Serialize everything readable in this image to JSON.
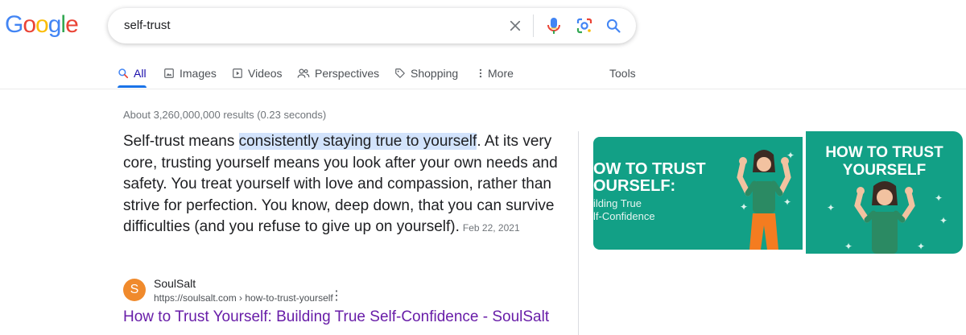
{
  "logo": {
    "text": [
      "G",
      "o",
      "o",
      "g",
      "l",
      "e"
    ],
    "colors": [
      "#4285f4",
      "#ea4335",
      "#fbbc05",
      "#4285f4",
      "#34a853",
      "#ea4335"
    ]
  },
  "search": {
    "query": "self-trust",
    "icons": [
      "close-icon",
      "microphone-icon",
      "lens-icon",
      "search-icon"
    ]
  },
  "tabs": [
    {
      "label": "All",
      "icon": "search-icon",
      "active": true
    },
    {
      "label": "Images",
      "icon": "image-icon"
    },
    {
      "label": "Videos",
      "icon": "video-icon"
    },
    {
      "label": "Perspectives",
      "icon": "people-icon"
    },
    {
      "label": "Shopping",
      "icon": "tag-icon"
    },
    {
      "label": "More",
      "icon": "more-vert-icon"
    }
  ],
  "tools_label": "Tools",
  "stats": "About 3,260,000,000 results (0.23 seconds)",
  "snippet": {
    "before": "Self-trust means ",
    "highlight": "consistently staying true to yourself",
    "after": ". At its very core, trusting yourself means you look after your own needs and safety. You treat yourself with love and compassion, rather than strive for perfection. You know, deep down, that you can survive difficulties (and you refuse to give up on yourself).",
    "date": "Feb 22, 2021"
  },
  "result": {
    "favicon_letter": "S",
    "site_name": "SoulSalt",
    "url": "https://soulsalt.com › how-to-trust-yourself",
    "title": "How to Trust Yourself: Building True Self-Confidence - SoulSalt"
  },
  "images": [
    {
      "line1": "OW TO TRUST",
      "line2": "OURSELF:",
      "sub1": "ilding True",
      "sub2": "lf-Confidence"
    },
    {
      "line1": "HOW TO TRUST",
      "line2": "YOURSELF"
    }
  ],
  "colors": {
    "link": "#1a0dab",
    "visited": "#681da8",
    "accent": "#1a73e8",
    "teal": "#12a086",
    "highlight": "#d2e3fc"
  }
}
